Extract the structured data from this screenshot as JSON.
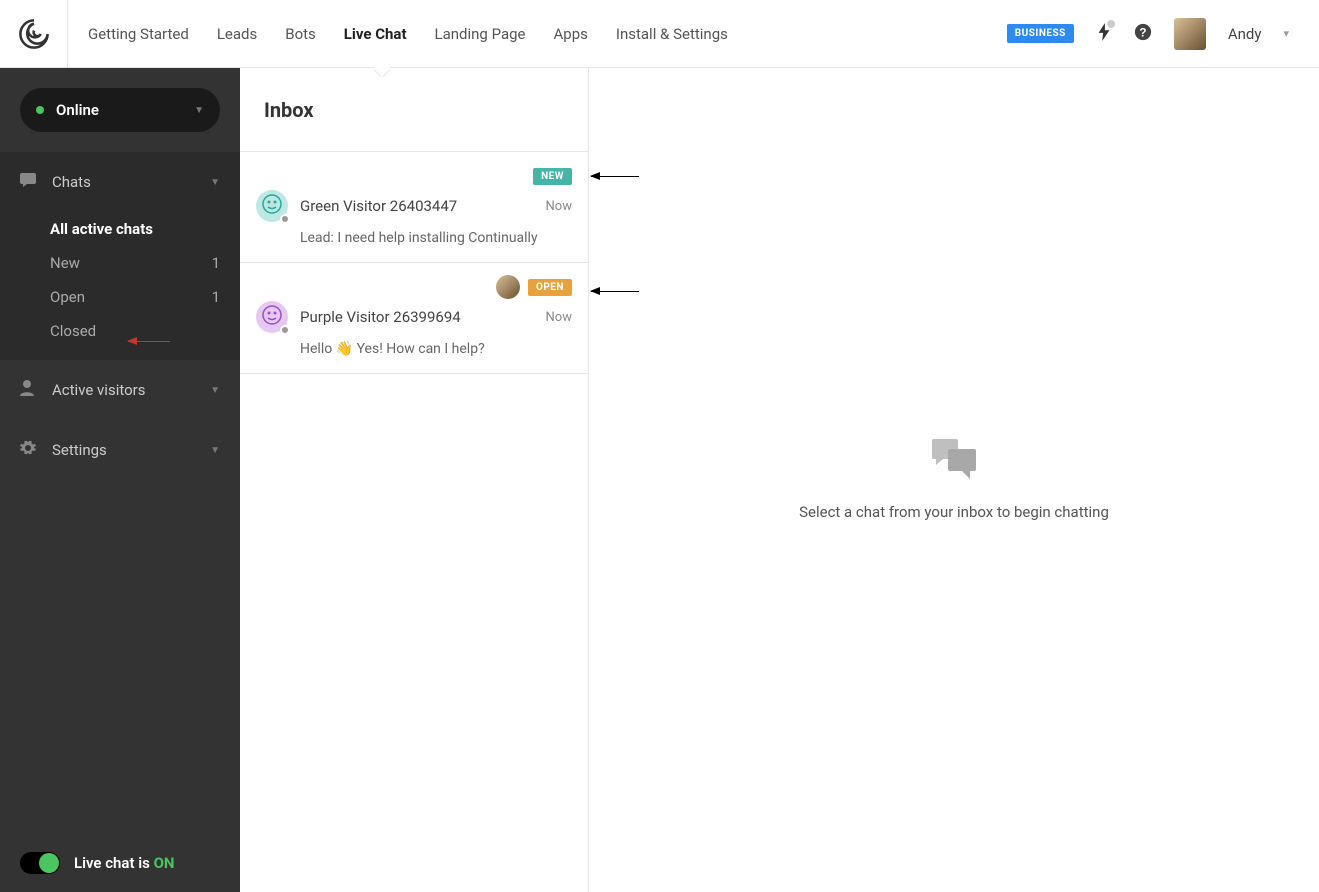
{
  "nav": {
    "items": [
      "Getting Started",
      "Leads",
      "Bots",
      "Live Chat",
      "Landing Page",
      "Apps",
      "Install & Settings"
    ],
    "active_index": 3,
    "plan_badge": "BUSINESS",
    "user_name": "Andy"
  },
  "sidebar": {
    "status": "Online",
    "sections": {
      "chats": {
        "label": "Chats",
        "items": [
          {
            "label": "All active chats",
            "count": null,
            "active": true
          },
          {
            "label": "New",
            "count": "1",
            "active": false
          },
          {
            "label": "Open",
            "count": "1",
            "active": false
          },
          {
            "label": "Closed",
            "count": null,
            "active": false
          }
        ]
      },
      "visitors": {
        "label": "Active visitors"
      },
      "settings": {
        "label": "Settings"
      }
    },
    "footer": {
      "prefix": "Live chat is ",
      "state": "ON"
    }
  },
  "inbox": {
    "title": "Inbox",
    "conversations": [
      {
        "badge": "NEW",
        "badge_color": "new",
        "show_agent_avatar": false,
        "visitor_name": "Green Visitor 26403447",
        "time": "Now",
        "preview": "Lead: I need help installing Continually",
        "avatar": "green"
      },
      {
        "badge": "OPEN",
        "badge_color": "open",
        "show_agent_avatar": true,
        "visitor_name": "Purple Visitor 26399694",
        "time": "Now",
        "preview": "Hello 👋 Yes! How can I help?",
        "avatar": "purple"
      }
    ]
  },
  "main": {
    "empty_text": "Select a chat from your inbox to begin chatting"
  },
  "colors": {
    "accent_green": "#4ac561",
    "badge_new": "#44b5a7",
    "badge_open": "#e8a23b",
    "business": "#2d8af0"
  }
}
